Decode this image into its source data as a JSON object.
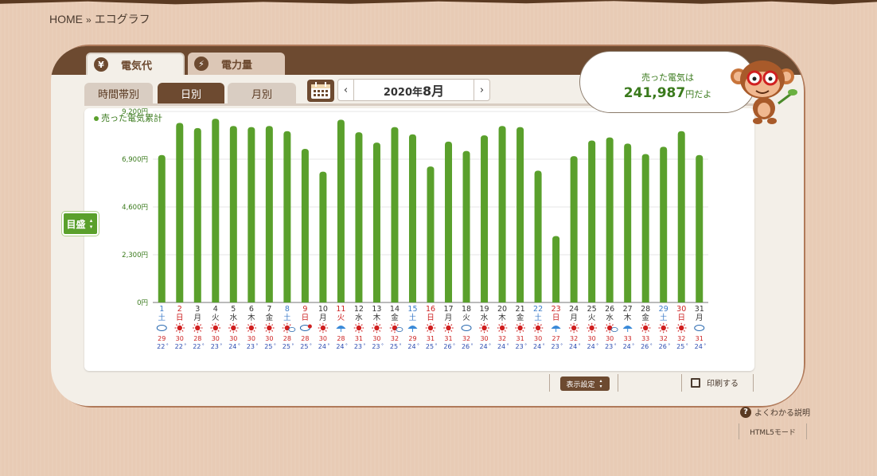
{
  "breadcrumb": {
    "home": "HOME",
    "separator": "»",
    "current": "エコグラフ"
  },
  "main_tabs": [
    {
      "label": "電気代",
      "icon": "yen-icon",
      "icon_glyph": "¥",
      "active": true
    },
    {
      "label": "電力量",
      "icon": "lightning-icon",
      "icon_glyph": "⚡",
      "active": false
    }
  ],
  "sub_tabs": [
    {
      "label": "時間帯別",
      "active": false
    },
    {
      "label": "日別",
      "active": true
    },
    {
      "label": "月別",
      "active": false
    }
  ],
  "month_nav": {
    "prev": "‹",
    "next": "›",
    "year_label": "2020年",
    "month_label": "8月"
  },
  "legend": {
    "label": "売った電気累計"
  },
  "unit_button": {
    "label": "目盛",
    "arrows": "▴▾"
  },
  "bubble": {
    "line1": "売った電気は",
    "value": "241,987",
    "suffix": "円だよ"
  },
  "controls": {
    "display_settings": "表示設定",
    "display_arrows": "▴▾",
    "print": "印刷する"
  },
  "help": {
    "q": "?",
    "label": "よくわかる説明"
  },
  "html5_mode": "HTML5モード",
  "colors": {
    "bar": "#5aa02c",
    "header": "#6d4a30",
    "sunday": "#cc2222",
    "saturday": "#3a7ac8",
    "weekday": "#333333",
    "max_temp": "#cc2222",
    "min_temp": "#2a4ab0"
  },
  "chart_data": {
    "type": "bar",
    "y_ticks": [
      "0円",
      "2,300円",
      "4,600円",
      "6,900円",
      "9,200円"
    ],
    "ylim": [
      0,
      9200
    ],
    "grid": true,
    "categories": [
      "1",
      "2",
      "3",
      "4",
      "5",
      "6",
      "7",
      "8",
      "9",
      "10",
      "11",
      "12",
      "13",
      "14",
      "15",
      "16",
      "17",
      "18",
      "19",
      "20",
      "21",
      "22",
      "23",
      "24",
      "25",
      "26",
      "27",
      "28",
      "29",
      "30",
      "31"
    ],
    "weekdays": [
      "土",
      "日",
      "月",
      "火",
      "水",
      "木",
      "金",
      "土",
      "日",
      "月",
      "火",
      "水",
      "木",
      "金",
      "土",
      "日",
      "月",
      "火",
      "水",
      "木",
      "金",
      "土",
      "日",
      "月",
      "火",
      "水",
      "木",
      "金",
      "土",
      "日",
      "月"
    ],
    "day_types": [
      "sat",
      "sun",
      "wk",
      "wk",
      "wk",
      "wk",
      "wk",
      "sat",
      "sun",
      "wk",
      "sun",
      "wk",
      "wk",
      "wk",
      "sat",
      "sun",
      "wk",
      "wk",
      "wk",
      "wk",
      "wk",
      "sat",
      "sun",
      "wk",
      "wk",
      "wk",
      "wk",
      "wk",
      "sat",
      "sun",
      "wk"
    ],
    "series": [
      {
        "values": [
          7100,
          8650,
          8400,
          8850,
          8500,
          8450,
          8500,
          8250,
          7400,
          6300,
          8800,
          8200,
          7700,
          8450,
          8100,
          6550,
          7750,
          7300,
          8050,
          8500,
          8450,
          6350,
          3200,
          7050,
          7800,
          7950,
          7650,
          7150,
          7500,
          8250,
          7100
        ]
      }
    ],
    "weather": [
      "cloudy",
      "sunny",
      "sunny",
      "sunny",
      "sunny",
      "sunny",
      "sunny",
      "sunny-cloudy",
      "cloudy-sunny",
      "sunny",
      "rain",
      "sunny",
      "sunny",
      "sunny-cloudy",
      "rain",
      "sunny",
      "sunny",
      "cloudy",
      "sunny",
      "sunny",
      "sunny",
      "sunny",
      "rain",
      "sunny",
      "sunny",
      "sunny-cloudy",
      "rain",
      "sunny",
      "sunny",
      "sunny",
      "cloudy"
    ],
    "max_temps": [
      "29",
      "30",
      "28",
      "30",
      "30",
      "30",
      "30",
      "28",
      "28",
      "30",
      "28",
      "31",
      "30",
      "32",
      "29",
      "31",
      "31",
      "32",
      "30",
      "32",
      "31",
      "30",
      "27",
      "32",
      "30",
      "30",
      "33",
      "33",
      "32",
      "32",
      "31"
    ],
    "min_temps": [
      "22",
      "22",
      "22",
      "23",
      "24",
      "23",
      "25",
      "25",
      "25",
      "24",
      "24",
      "23",
      "23",
      "25",
      "24",
      "25",
      "26",
      "26",
      "24",
      "24",
      "23",
      "24",
      "23",
      "24",
      "24",
      "23",
      "24",
      "26",
      "26",
      "25",
      "24"
    ],
    "temp_unit": "°"
  }
}
